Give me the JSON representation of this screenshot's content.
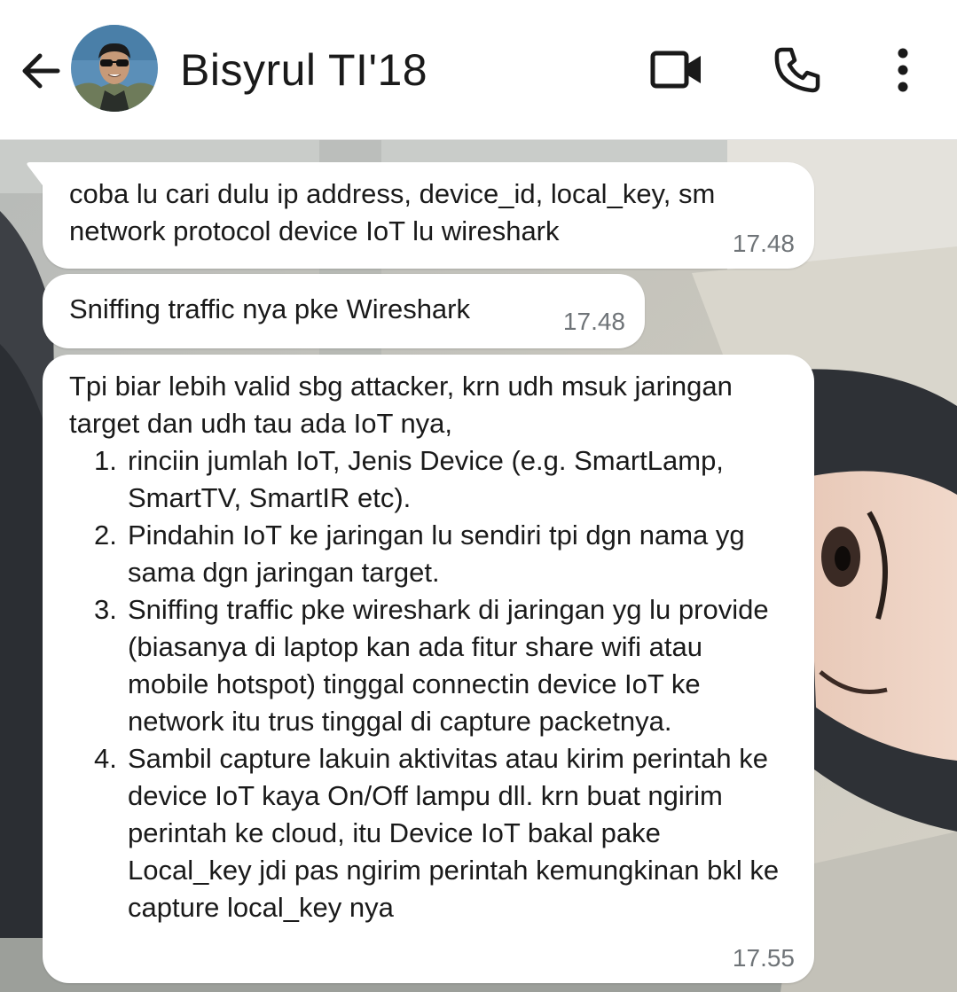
{
  "header": {
    "contact_name": "Bisyrul TI'18",
    "icons": {
      "back": "arrow-left-icon",
      "video": "video-call-icon",
      "call": "phone-icon",
      "menu": "more-vert-icon"
    }
  },
  "messages": [
    {
      "text": "coba lu cari dulu ip address, device_id, local_key, sm network protocol device IoT lu wireshark",
      "time": "17.48"
    },
    {
      "text": "Sniffing traffic nya pke Wireshark",
      "time": "17.48"
    },
    {
      "intro": "Tpi biar lebih valid sbg attacker, krn udh msuk jaringan target dan udh tau ada IoT nya,",
      "steps": [
        {
          "num": "1.",
          "text": "rinciin jumlah IoT, Jenis Device (e.g. SmartLamp, SmartTV, SmartIR etc)."
        },
        {
          "num": "2.",
          "text": "Pindahin IoT ke jaringan lu sendiri tpi dgn nama yg sama dgn jaringan target."
        },
        {
          "num": "3.",
          "text": "Sniffing traffic pke wireshark di jaringan yg lu provide (biasanya di laptop kan ada fitur share wifi atau mobile hotspot) tinggal connectin device IoT ke network itu trus tinggal di capture packetnya."
        },
        {
          "num": "4.",
          "text": "Sambil capture lakuin aktivitas atau kirim perintah ke device IoT kaya On/Off lampu dll. krn buat ngirim perintah ke cloud, itu Device IoT bakal pake Local_key jdi pas ngirim perintah kemungkinan bkl ke capture local_key nya"
        }
      ],
      "time": "17.55"
    }
  ],
  "colors": {
    "header_bg": "#ffffff",
    "bubble_bg": "#ffffff",
    "text": "#1a1a1a",
    "time_text": "#6f7478",
    "icon": "#1a1a1a"
  }
}
